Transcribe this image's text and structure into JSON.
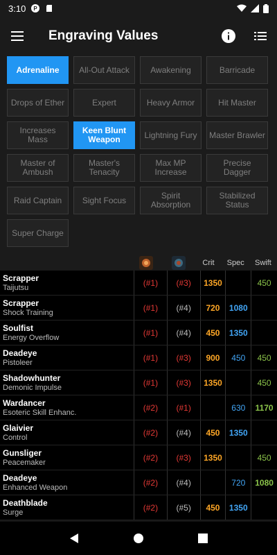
{
  "status": {
    "time": "3:10"
  },
  "header": {
    "title": "Engraving Values"
  },
  "icons": {
    "menu": "menu-icon",
    "info": "info-icon",
    "list": "list-icon"
  },
  "chips": [
    {
      "label": "Adrenaline",
      "active": true
    },
    {
      "label": "All-Out Attack",
      "active": false
    },
    {
      "label": "Awakening",
      "active": false
    },
    {
      "label": "Barricade",
      "active": false
    },
    {
      "label": "Drops of Ether",
      "active": false
    },
    {
      "label": "Expert",
      "active": false
    },
    {
      "label": "Heavy Armor",
      "active": false
    },
    {
      "label": "Hit Master",
      "active": false
    },
    {
      "label": "Increases Mass",
      "active": false
    },
    {
      "label": "Keen Blunt Weapon",
      "active": true
    },
    {
      "label": "Lightning Fury",
      "active": false
    },
    {
      "label": "Master Brawler",
      "active": false
    },
    {
      "label": "Master of Ambush",
      "active": false
    },
    {
      "label": "Master's Tenacity",
      "active": false
    },
    {
      "label": "Max MP Increase",
      "active": false
    },
    {
      "label": "Precise Dagger",
      "active": false
    },
    {
      "label": "Raid Captain",
      "active": false
    },
    {
      "label": "Sight Focus",
      "active": false
    },
    {
      "label": "Spirit Absorption",
      "active": false
    },
    {
      "label": "Stabilized Status",
      "active": false
    },
    {
      "label": "Super Charge",
      "active": false
    }
  ],
  "table": {
    "columns": {
      "crit": "Crit",
      "spec": "Spec",
      "swift": "Swift"
    },
    "rows": [
      {
        "class": "Scrapper",
        "engraving": "Taijutsu",
        "r1": "(#1)",
        "r1c": "red",
        "r2": "(#3)",
        "r2c": "red",
        "crit": "1350",
        "spec": "",
        "swift": "450"
      },
      {
        "class": "Scrapper",
        "engraving": "Shock Training",
        "r1": "(#1)",
        "r1c": "red",
        "r2": "(#4)",
        "r2c": "gray",
        "crit": "720",
        "spec": "1080",
        "swift": ""
      },
      {
        "class": "Soulfist",
        "engraving": "Energy Overflow",
        "r1": "(#1)",
        "r1c": "red",
        "r2": "(#4)",
        "r2c": "gray",
        "crit": "450",
        "spec": "1350",
        "swift": ""
      },
      {
        "class": "Deadeye",
        "engraving": "Pistoleer",
        "r1": "(#1)",
        "r1c": "red",
        "r2": "(#3)",
        "r2c": "red",
        "crit": "900",
        "spec": "450",
        "swift": "450"
      },
      {
        "class": "Shadowhunter",
        "engraving": "Demonic Impulse",
        "r1": "(#1)",
        "r1c": "red",
        "r2": "(#3)",
        "r2c": "red",
        "crit": "1350",
        "spec": "",
        "swift": "450"
      },
      {
        "class": "Wardancer",
        "engraving": "Esoteric Skill Enhanc.",
        "r1": "(#2)",
        "r1c": "red",
        "r2": "(#1)",
        "r2c": "red",
        "crit": "",
        "spec": "630",
        "swift": "1170"
      },
      {
        "class": "Glaivier",
        "engraving": "Control",
        "r1": "(#2)",
        "r1c": "red",
        "r2": "(#4)",
        "r2c": "gray",
        "crit": "450",
        "spec": "1350",
        "swift": ""
      },
      {
        "class": "Gunsliger",
        "engraving": "Peacemaker",
        "r1": "(#2)",
        "r1c": "red",
        "r2": "(#3)",
        "r2c": "red",
        "crit": "1350",
        "spec": "",
        "swift": "450"
      },
      {
        "class": "Deadeye",
        "engraving": "Enhanced Weapon",
        "r1": "(#2)",
        "r1c": "red",
        "r2": "(#4)",
        "r2c": "gray",
        "crit": "",
        "spec": "720",
        "swift": "1080"
      },
      {
        "class": "Deathblade",
        "engraving": "Surge",
        "r1": "(#2)",
        "r1c": "red",
        "r2": "(#5)",
        "r2c": "gray",
        "crit": "450",
        "spec": "1350",
        "swift": ""
      }
    ]
  },
  "navbar": {
    "back": "back-icon",
    "home": "home-icon",
    "recents": "recents-icon"
  }
}
